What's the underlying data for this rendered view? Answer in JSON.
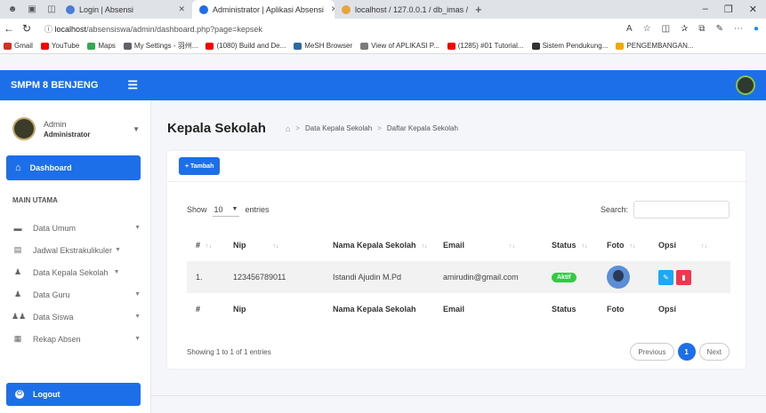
{
  "browser": {
    "tabs": [
      {
        "label": "Login | Absensi",
        "color": "#4a7dd6"
      },
      {
        "label": "Administrator | Aplikasi Absensi",
        "color": "#1c6fe8"
      },
      {
        "label": "localhost / 127.0.0.1 / db_imas /",
        "color": "#e8a33d"
      }
    ],
    "new_tab": "+",
    "url_host": "localhost",
    "url_path": "/absensiswa/admin/dashboard.php?page=kepsek",
    "bookmarks": [
      {
        "label": "Gmail",
        "color": "#d93025"
      },
      {
        "label": "YouTube",
        "color": "#ff0000"
      },
      {
        "label": "Maps",
        "color": "#34a853"
      },
      {
        "label": "My Settings - 羽州...",
        "color": "#5f6368"
      },
      {
        "label": "(1080) Build and De...",
        "color": "#ff0000"
      },
      {
        "label": "MeSH Browser",
        "color": "#2d6a9f"
      },
      {
        "label": "View of APLIKASI P...",
        "color": "#7a7a7a"
      },
      {
        "label": "(1285) #01 Tutorial...",
        "color": "#ff0000"
      },
      {
        "label": "Sistem Pendukung...",
        "color": "#333333"
      },
      {
        "label": "PENGEMBANGAN...",
        "color": "#f2a900"
      }
    ]
  },
  "app": {
    "brand": "SMPM 8 BENJENG",
    "accent": "#1c6fe8"
  },
  "sidebar": {
    "user_name": "Admin",
    "user_role": "Administrator",
    "dashboard": "Dashboard",
    "section": "MAIN UTAMA",
    "items": [
      {
        "label": "Data Umum",
        "icon": "folder-icon"
      },
      {
        "label": "Jadwal Ekstrakulikuler",
        "icon": "clipboard-icon"
      },
      {
        "label": "Data Kepala Sekolah",
        "icon": "user-tie-icon"
      },
      {
        "label": "Data Guru",
        "icon": "user-tie-icon"
      },
      {
        "label": "Data Siswa",
        "icon": "users-icon"
      },
      {
        "label": "Rekap Absen",
        "icon": "list-icon"
      }
    ],
    "logout": "Logout"
  },
  "page": {
    "title": "Kepala Sekolah",
    "breadcrumb": [
      "Data Kepala Sekolah",
      "Daftar Kepala Sekolah"
    ]
  },
  "card": {
    "add_label": "+ Tambah",
    "show_label": "Show",
    "entries_value": "10",
    "entries_label": "entries",
    "search_label": "Search:",
    "columns": [
      "#",
      "Nip",
      "Nama Kepala Sekolah",
      "Email",
      "Status",
      "Foto",
      "Opsi"
    ],
    "rows": [
      {
        "no": "1.",
        "nip": "123456789011",
        "nama": "Istandi Ajudin M.Pd",
        "email": "amirudin@gmail.com",
        "status": "Aktif"
      }
    ],
    "info": "Showing 1 to 1 of 1 entries",
    "prev": "Previous",
    "current_page": "1",
    "next": "Next"
  }
}
